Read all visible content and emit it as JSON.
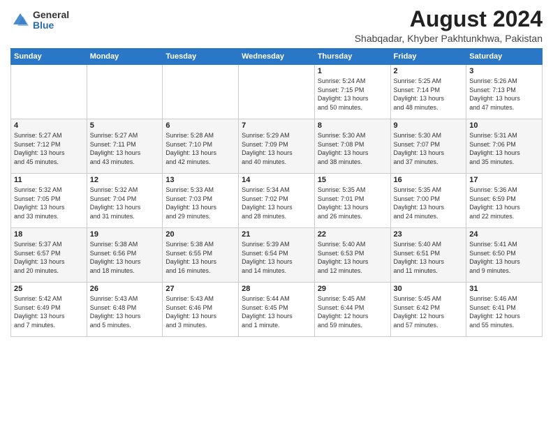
{
  "logo": {
    "general": "General",
    "blue": "Blue"
  },
  "title": {
    "month_year": "August 2024",
    "location": "Shabqadar, Khyber Pakhtunkhwa, Pakistan"
  },
  "headers": [
    "Sunday",
    "Monday",
    "Tuesday",
    "Wednesday",
    "Thursday",
    "Friday",
    "Saturday"
  ],
  "weeks": [
    [
      {
        "day": "",
        "info": ""
      },
      {
        "day": "",
        "info": ""
      },
      {
        "day": "",
        "info": ""
      },
      {
        "day": "",
        "info": ""
      },
      {
        "day": "1",
        "info": "Sunrise: 5:24 AM\nSunset: 7:15 PM\nDaylight: 13 hours\nand 50 minutes."
      },
      {
        "day": "2",
        "info": "Sunrise: 5:25 AM\nSunset: 7:14 PM\nDaylight: 13 hours\nand 48 minutes."
      },
      {
        "day": "3",
        "info": "Sunrise: 5:26 AM\nSunset: 7:13 PM\nDaylight: 13 hours\nand 47 minutes."
      }
    ],
    [
      {
        "day": "4",
        "info": "Sunrise: 5:27 AM\nSunset: 7:12 PM\nDaylight: 13 hours\nand 45 minutes."
      },
      {
        "day": "5",
        "info": "Sunrise: 5:27 AM\nSunset: 7:11 PM\nDaylight: 13 hours\nand 43 minutes."
      },
      {
        "day": "6",
        "info": "Sunrise: 5:28 AM\nSunset: 7:10 PM\nDaylight: 13 hours\nand 42 minutes."
      },
      {
        "day": "7",
        "info": "Sunrise: 5:29 AM\nSunset: 7:09 PM\nDaylight: 13 hours\nand 40 minutes."
      },
      {
        "day": "8",
        "info": "Sunrise: 5:30 AM\nSunset: 7:08 PM\nDaylight: 13 hours\nand 38 minutes."
      },
      {
        "day": "9",
        "info": "Sunrise: 5:30 AM\nSunset: 7:07 PM\nDaylight: 13 hours\nand 37 minutes."
      },
      {
        "day": "10",
        "info": "Sunrise: 5:31 AM\nSunset: 7:06 PM\nDaylight: 13 hours\nand 35 minutes."
      }
    ],
    [
      {
        "day": "11",
        "info": "Sunrise: 5:32 AM\nSunset: 7:05 PM\nDaylight: 13 hours\nand 33 minutes."
      },
      {
        "day": "12",
        "info": "Sunrise: 5:32 AM\nSunset: 7:04 PM\nDaylight: 13 hours\nand 31 minutes."
      },
      {
        "day": "13",
        "info": "Sunrise: 5:33 AM\nSunset: 7:03 PM\nDaylight: 13 hours\nand 29 minutes."
      },
      {
        "day": "14",
        "info": "Sunrise: 5:34 AM\nSunset: 7:02 PM\nDaylight: 13 hours\nand 28 minutes."
      },
      {
        "day": "15",
        "info": "Sunrise: 5:35 AM\nSunset: 7:01 PM\nDaylight: 13 hours\nand 26 minutes."
      },
      {
        "day": "16",
        "info": "Sunrise: 5:35 AM\nSunset: 7:00 PM\nDaylight: 13 hours\nand 24 minutes."
      },
      {
        "day": "17",
        "info": "Sunrise: 5:36 AM\nSunset: 6:59 PM\nDaylight: 13 hours\nand 22 minutes."
      }
    ],
    [
      {
        "day": "18",
        "info": "Sunrise: 5:37 AM\nSunset: 6:57 PM\nDaylight: 13 hours\nand 20 minutes."
      },
      {
        "day": "19",
        "info": "Sunrise: 5:38 AM\nSunset: 6:56 PM\nDaylight: 13 hours\nand 18 minutes."
      },
      {
        "day": "20",
        "info": "Sunrise: 5:38 AM\nSunset: 6:55 PM\nDaylight: 13 hours\nand 16 minutes."
      },
      {
        "day": "21",
        "info": "Sunrise: 5:39 AM\nSunset: 6:54 PM\nDaylight: 13 hours\nand 14 minutes."
      },
      {
        "day": "22",
        "info": "Sunrise: 5:40 AM\nSunset: 6:53 PM\nDaylight: 13 hours\nand 12 minutes."
      },
      {
        "day": "23",
        "info": "Sunrise: 5:40 AM\nSunset: 6:51 PM\nDaylight: 13 hours\nand 11 minutes."
      },
      {
        "day": "24",
        "info": "Sunrise: 5:41 AM\nSunset: 6:50 PM\nDaylight: 13 hours\nand 9 minutes."
      }
    ],
    [
      {
        "day": "25",
        "info": "Sunrise: 5:42 AM\nSunset: 6:49 PM\nDaylight: 13 hours\nand 7 minutes."
      },
      {
        "day": "26",
        "info": "Sunrise: 5:43 AM\nSunset: 6:48 PM\nDaylight: 13 hours\nand 5 minutes."
      },
      {
        "day": "27",
        "info": "Sunrise: 5:43 AM\nSunset: 6:46 PM\nDaylight: 13 hours\nand 3 minutes."
      },
      {
        "day": "28",
        "info": "Sunrise: 5:44 AM\nSunset: 6:45 PM\nDaylight: 13 hours\nand 1 minute."
      },
      {
        "day": "29",
        "info": "Sunrise: 5:45 AM\nSunset: 6:44 PM\nDaylight: 12 hours\nand 59 minutes."
      },
      {
        "day": "30",
        "info": "Sunrise: 5:45 AM\nSunset: 6:42 PM\nDaylight: 12 hours\nand 57 minutes."
      },
      {
        "day": "31",
        "info": "Sunrise: 5:46 AM\nSunset: 6:41 PM\nDaylight: 12 hours\nand 55 minutes."
      }
    ]
  ]
}
